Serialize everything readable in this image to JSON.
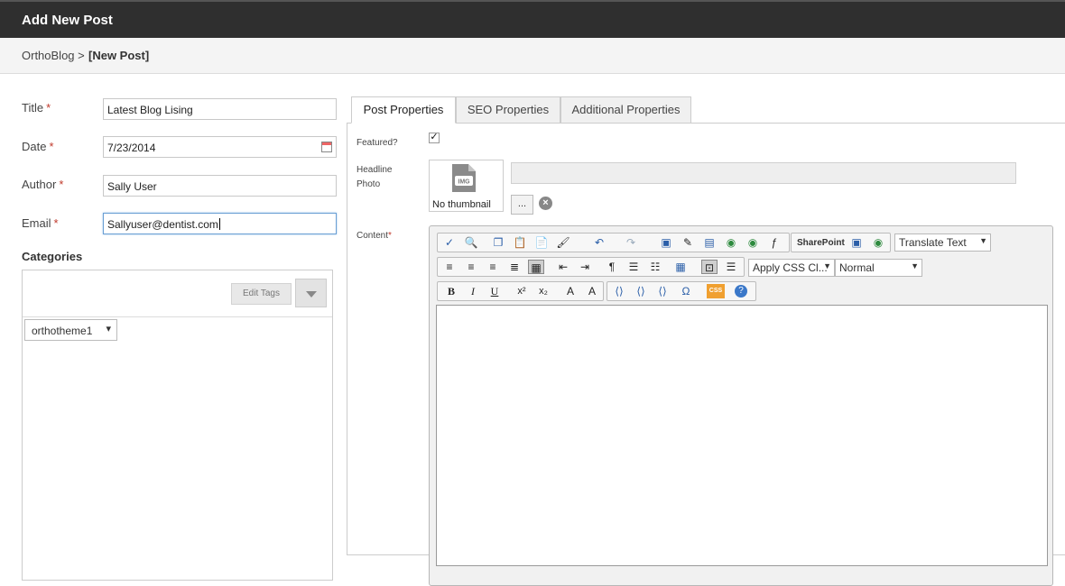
{
  "header": {
    "title": "Add New Post"
  },
  "breadcrumb": {
    "root": "OrthoBlog >",
    "current": "[New Post]"
  },
  "form": {
    "title_label": "Title",
    "title_value": "Latest Blog Lising",
    "date_label": "Date",
    "date_value": "7/23/2014",
    "author_label": "Author",
    "author_value": "Sally User",
    "email_label": "Email",
    "email_value": "Sallyuser@dentist.com",
    "required_mark": "*"
  },
  "categories": {
    "title": "Categories",
    "edit_tags_label": "Edit Tags",
    "theme_select": "orthotheme1",
    "select_arrow": "▾"
  },
  "tabs": [
    {
      "label": "Post Properties",
      "active": true
    },
    {
      "label": "SEO Properties",
      "active": false
    },
    {
      "label": "Additional Properties",
      "active": false
    }
  ],
  "post_properties": {
    "featured_label": "Featured?",
    "featured_checked": true,
    "headline_label_1": "Headline",
    "headline_label_2": "Photo",
    "img_badge": "IMG",
    "no_thumbnail": "No thumbnail",
    "browse_label": "...",
    "remove_symbol": "×",
    "content_label": "Content",
    "content_required": "*"
  },
  "editor_toolbar": {
    "sharepoint_label": "SharePoint",
    "translate_label": "Translate Text",
    "css_class_select": "Apply CSS Cl...",
    "format_select": "Normal",
    "bold": "B",
    "italic": "I",
    "underline": "U",
    "superscript": "x²",
    "subscript": "x₂",
    "omega": "Ω",
    "css_badge": "CSS",
    "help": "?"
  },
  "colors": {
    "header_bg": "#2f2f2f",
    "required": "#c0392b",
    "link_blue": "#2a5ea8"
  }
}
